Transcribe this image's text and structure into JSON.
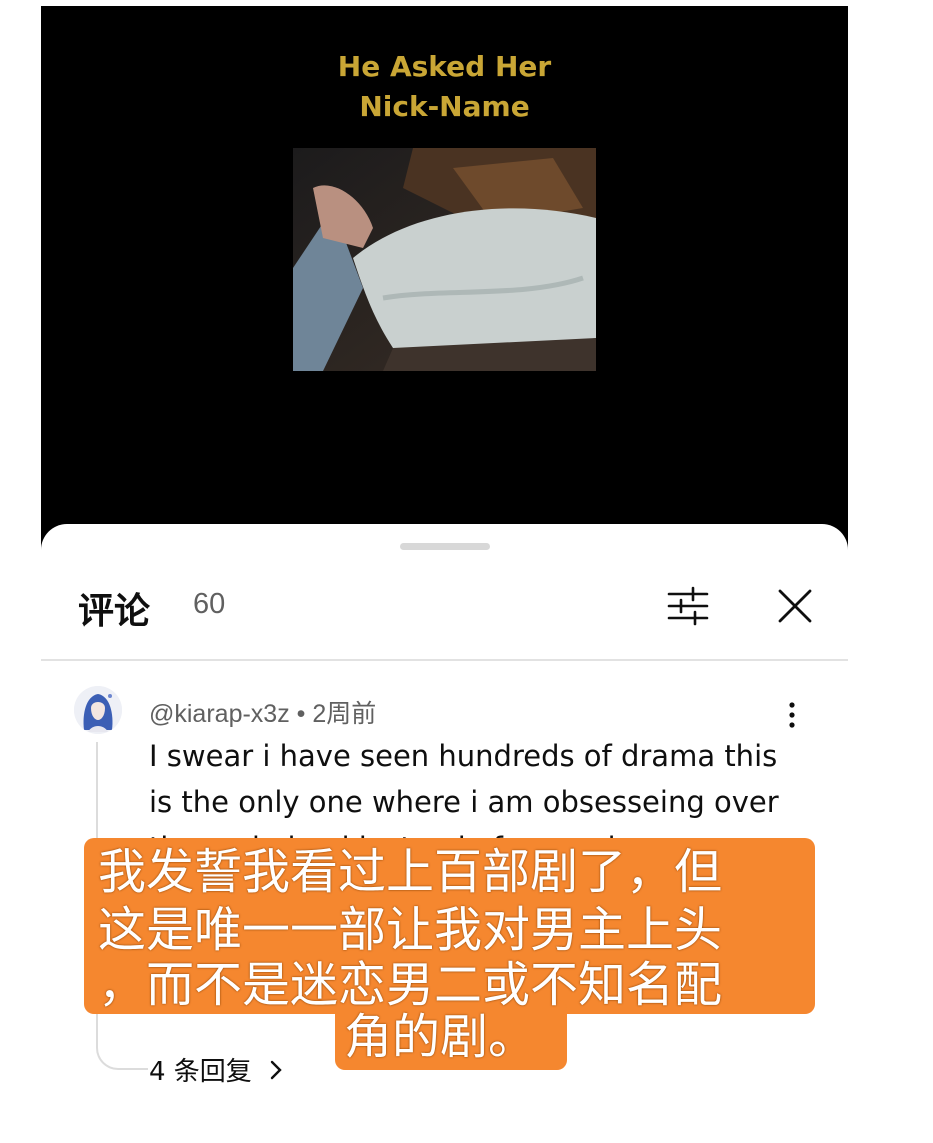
{
  "video": {
    "title_line1": "He Asked Her",
    "title_line2": "Nick-Name"
  },
  "comments_panel": {
    "title": "评论",
    "count": "60",
    "icons": {
      "filter": "sliders-icon",
      "close": "close-icon"
    }
  },
  "comment": {
    "username": "@kiarap-x3z",
    "separator": "•",
    "time": "2周前",
    "text": "I swear i have seen hundreds of drama this is the only one where i am obsesseing over the main lead instead of second or",
    "replies": "4 条回复",
    "replies_icon": "chevron-right-icon"
  },
  "subtitle": {
    "line1": "我发誓我看过上百部剧了，但",
    "line2": "这是唯一一部让我对男主上头",
    "line3": "，而不是迷恋男二或不知名配",
    "line4": "角的剧。",
    "color": "#f5872f"
  }
}
